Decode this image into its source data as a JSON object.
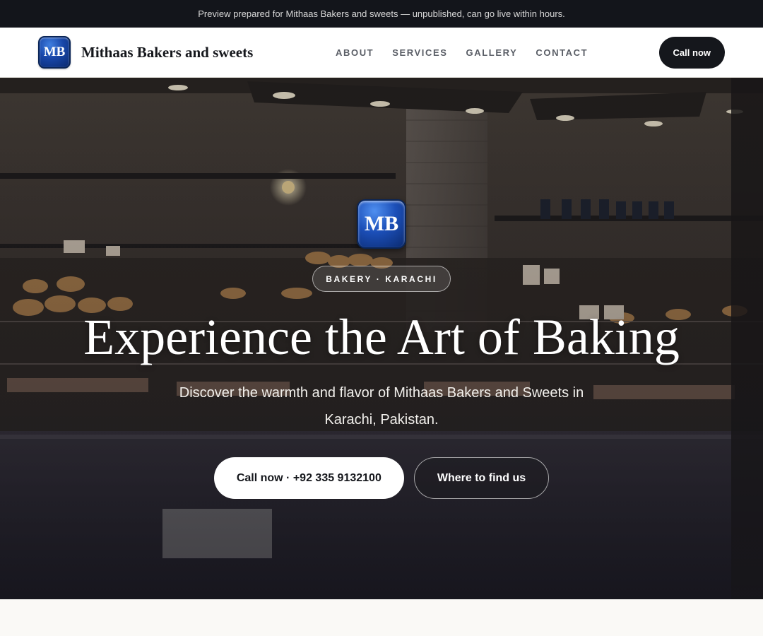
{
  "preview_bar": {
    "text": "Preview prepared for Mithaas Bakers and sweets — unpublished, can go live within hours."
  },
  "header": {
    "logo_text": "MB",
    "brand_name": "Mithaas Bakers and sweets",
    "nav": [
      {
        "label": "ABOUT"
      },
      {
        "label": "SERVICES"
      },
      {
        "label": "GALLERY"
      },
      {
        "label": "CONTACT"
      }
    ],
    "cta_label": "Call now"
  },
  "hero": {
    "logo_text": "MB",
    "badge": "BAKERY · KARACHI",
    "title": "Experience the Art of Baking",
    "subtitle": "Discover the warmth and flavor of Mithaas Bakers and Sweets in Karachi, Pakistan.",
    "primary_button": "Call now · +92 335 9132100",
    "secondary_button": "Where to find us"
  },
  "colors": {
    "dark": "#15171c",
    "logo_blue": "#1846a8",
    "page_bg": "#faf9f6"
  }
}
